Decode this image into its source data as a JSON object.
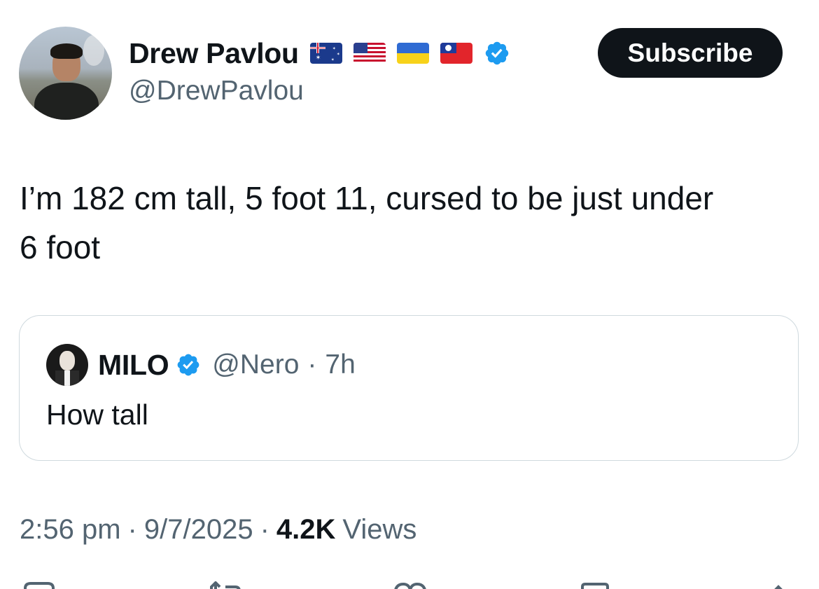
{
  "author": {
    "display_name": "Drew Pavlou",
    "handle": "@DrewPavlou",
    "flags": [
      "australia-flag",
      "usa-flag",
      "ukraine-flag",
      "taiwan-flag"
    ],
    "verified": true
  },
  "subscribe_label": "Subscribe",
  "tweet_text": "I’m 182 cm tall, 5 foot 11, cursed to be just under\n6 foot",
  "quoted_tweet": {
    "display_name": "MILO",
    "handle": "@Nero",
    "separator": "·",
    "time": "7h",
    "text": "How tall",
    "verified": true
  },
  "meta": {
    "time": "2:56 pm",
    "sep1": "·",
    "date": "9/7/2025",
    "sep2": "·",
    "views_count": "4.2K",
    "views_label": "Views"
  },
  "action_icons": [
    "reply-icon",
    "retweet-icon",
    "like-icon",
    "bookmark-icon",
    "share-icon"
  ],
  "colors": {
    "text": "#0f1419",
    "secondary": "#536471",
    "verified_blue": "#1d9bf0",
    "border": "#cfd9de",
    "button_bg": "#0f1419"
  }
}
